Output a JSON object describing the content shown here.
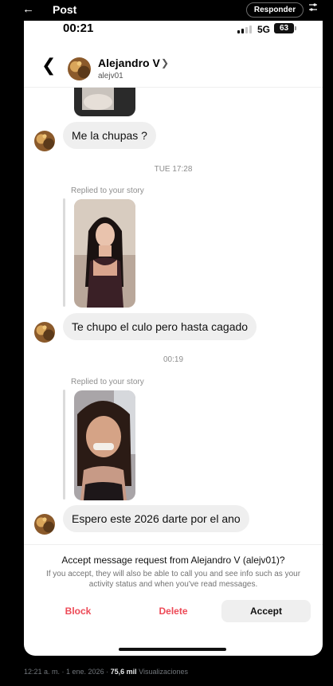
{
  "post_bar": {
    "title": "Post",
    "reply_label": "Responder"
  },
  "status_bar": {
    "time": "00:21",
    "network": "5G",
    "battery": "63"
  },
  "chat_header": {
    "name": "Alejandro V",
    "handle": "alejv01"
  },
  "messages": {
    "m1": "Me la chupas ?",
    "ts1": "TUE 17:28",
    "reply1": "Replied to your story",
    "m2": "Te chupo el culo pero hasta cagado",
    "ts2": "00:19",
    "reply2": "Replied to your story",
    "m3": "Espero este 2026 darte por el ano"
  },
  "request": {
    "question": "Accept message request from Alejandro V (alejv01)?",
    "subtext": "If you accept, they will also be able to call you and see info such as your activity status and when you've read messages.",
    "block_label": "Block",
    "delete_label": "Delete",
    "accept_label": "Accept"
  },
  "footer": {
    "datetime": "12:21 a. m. · 1 ene. 2026 · ",
    "views_count": "75,6 mil",
    "views_label": " Visualizaciones"
  },
  "icons": {
    "back": "arrow-left-icon",
    "adjust": "sliders-icon",
    "chevron": "chevron-left-icon",
    "profile_chevron": "chevron-right-icon"
  },
  "colors": {
    "danger": "#ed4956",
    "bubble": "#efefef",
    "meta_text": "#8e8e8e"
  }
}
